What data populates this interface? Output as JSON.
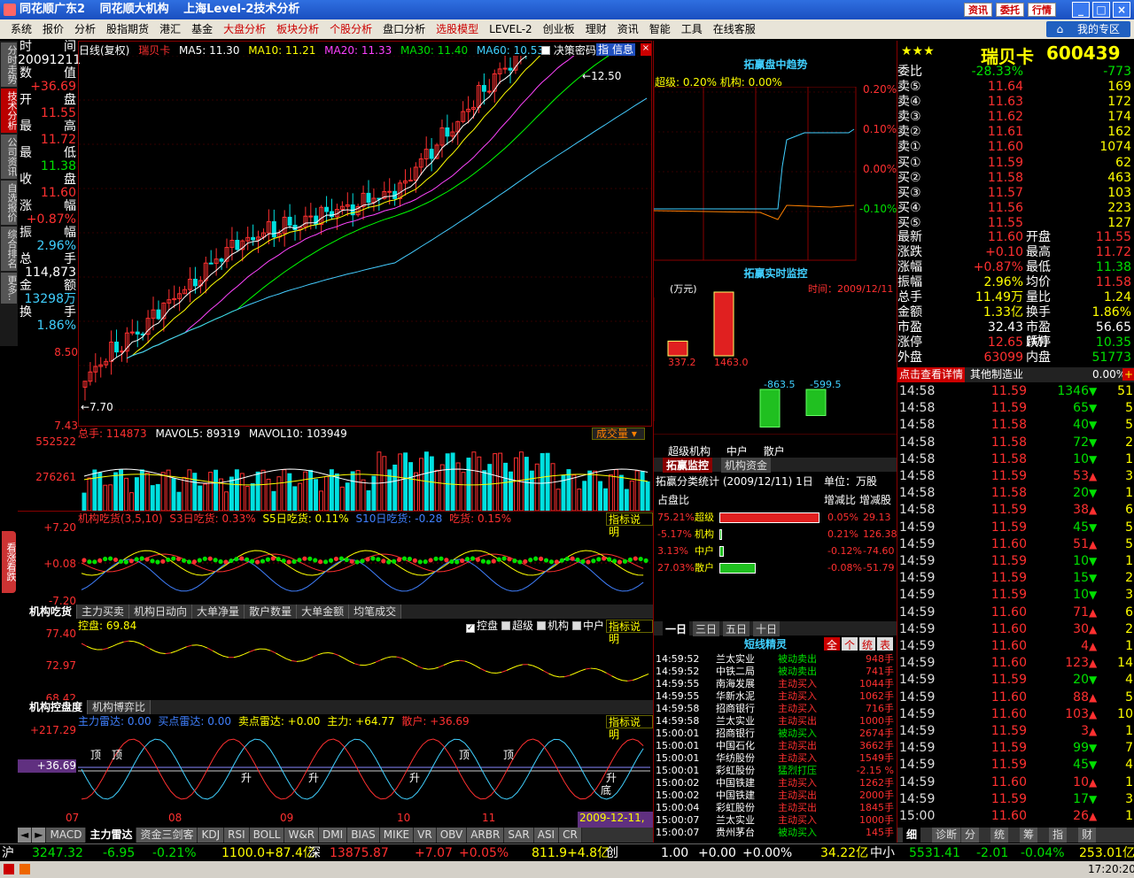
{
  "titlebar": {
    "app": "同花顺广东2",
    "mode": "同花顺大机构",
    "page": "上海Level-2技术分析",
    "btn1": "资讯",
    "btn2": "委托",
    "btn3": "行情"
  },
  "menu": {
    "items": [
      "系统",
      "报价",
      "分析",
      "股指期货",
      "港汇",
      "基金",
      "大盘分析",
      "板块分析",
      "个股分析",
      "盘口分析",
      "选股模型",
      "LEVEL-2",
      "创业板",
      "理财",
      "资讯",
      "智能",
      "工具",
      "在线客服"
    ],
    "red_items": [
      "大盘分析",
      "板块分析",
      "个股分析",
      "选股模型"
    ],
    "myzone": "我的专区"
  },
  "left_tabs": [
    "分时走势",
    "技术分析",
    "公司资讯",
    "自选报价",
    "综合排名",
    "更多.."
  ],
  "info": {
    "rows": [
      {
        "l": "时",
        "r": "间"
      },
      {
        "val": "20091211",
        "color": "white"
      },
      {
        "l": "数",
        "r": "值"
      },
      {
        "val": "+36.69",
        "color": "red"
      },
      {
        "l": "开",
        "r": "盘"
      },
      {
        "val": "11.55",
        "color": "red"
      },
      {
        "l": "最",
        "r": "高"
      },
      {
        "val": "11.72",
        "color": "red"
      },
      {
        "l": "最",
        "r": "低"
      },
      {
        "val": "11.38",
        "color": "green"
      },
      {
        "l": "收",
        "r": "盘"
      },
      {
        "val": "11.60",
        "color": "red"
      },
      {
        "l": "涨",
        "r": "幅"
      },
      {
        "val": "+0.87%",
        "color": "red"
      },
      {
        "l": "振",
        "r": "幅"
      },
      {
        "val": "2.96%",
        "color": "cyan"
      },
      {
        "l": "总",
        "r": "手"
      },
      {
        "val": "114,873",
        "color": "white"
      },
      {
        "l": "金",
        "r": "额"
      },
      {
        "val": "13298万",
        "color": "cyan"
      },
      {
        "l": "换",
        "r": "手"
      },
      {
        "val": "1.86%",
        "color": "cyan"
      }
    ],
    "price_axis": [
      "8.50",
      "7.43"
    ]
  },
  "main_chart": {
    "header": {
      "label": "日线(复权)",
      "name": "瑞贝卡",
      "ma5": "MA5: 11.30",
      "ma10": "MA10: 11.21",
      "ma20": "MA20: 11.33",
      "ma30": "MA30: 11.40",
      "ma60": "MA60: 10.53"
    },
    "decision": "决策密码",
    "icons": [
      "指",
      "信息"
    ],
    "high_label": "12.50",
    "low_label": "7.70"
  },
  "vol_panel": {
    "header": "总手: 114873",
    "mavol5": "MAVOL5: 89319",
    "mavol10": "MAVOL10: 103949",
    "select": "成交量",
    "axis": [
      "552522",
      "276261"
    ]
  },
  "inst_panel": {
    "header": "机构吃货(3,5,10)",
    "s3": "S3日吃货: 0.33%",
    "s5": "S5日吃货: 0.11%",
    "s10": "S10日吃货: -0.28",
    "eat": "吃货: 0.15%",
    "explain": "指标说明",
    "axis": [
      "+7.20",
      "+0.08",
      "-7.20"
    ],
    "side_tab": "看涨看跌"
  },
  "tabs1": [
    "机构吃货",
    "主力买卖",
    "机构日动向",
    "大单净量",
    "散户数量",
    "大单金额",
    "均笔成交"
  ],
  "ctrl_panel": {
    "header": "控盘: 69.84",
    "checks": [
      "控盘",
      "超级",
      "机构",
      "中户"
    ],
    "explain": "指标说明",
    "axis": [
      "77.40",
      "72.97",
      "68.42"
    ]
  },
  "tabs2": [
    "机构控盘度",
    "机构博弈比"
  ],
  "radar_panel": {
    "header": "主力雷达: 0.00",
    "buy": "买点雷达: 0.00",
    "sell": "卖点雷达: +0.00",
    "main": "主力: +64.77",
    "retail": "散户: +36.69",
    "explain": "指标说明",
    "axis": [
      "+217.29",
      "+36.69"
    ],
    "markers": [
      "顶",
      "顶",
      "顶",
      "顶",
      "升",
      "升",
      "升",
      "升",
      "底"
    ]
  },
  "date_axis": [
    "07",
    "08",
    "09",
    "10",
    "11",
    "2009-12-11,五"
  ],
  "bottom_tabs": [
    "MACD",
    "主力雷达",
    "资金三剑客",
    "KDJ",
    "RSI",
    "BOLL",
    "W&R",
    "DMI",
    "BIAS",
    "MIKE",
    "VR",
    "OBV",
    "ARBR",
    "SAR",
    "ASI",
    "CR"
  ],
  "mid": {
    "trend_title": "拓赢盘中趋势",
    "trend_hdr": "超级: 0.20%  机构: 0.00%",
    "trend_axis": [
      "0.20%",
      "0.10%",
      "0.00%",
      "-0.10%"
    ],
    "monitor_title": "拓赢实时监控",
    "monitor_unit": "(万元)",
    "monitor_time": "时间：2009/12/11",
    "bars": [
      {
        "v": "337.2",
        "val": 337.2
      },
      {
        "v": "1463.0",
        "val": 1463.0
      },
      {
        "v": "-863.5",
        "val": -863.5
      },
      {
        "v": "-599.5",
        "val": -599.5
      }
    ],
    "bar_labels": [
      "超级机构",
      "机构",
      "中户",
      "散户"
    ],
    "tabs": [
      "拓赢监控",
      "机构资金"
    ],
    "stat_title": "拓赢分类统计 (2009/12/11) 1日",
    "stat_unit": "单位：万股",
    "stat_hdr": [
      "占盘比",
      "增减比",
      "增减股"
    ],
    "stats": [
      {
        "pct": "75.21%",
        "name": "超级",
        "chg": "0.05%",
        "vol": "29.13",
        "w": 0.75
      },
      {
        "pct": "-5.17%",
        "name": "机构",
        "chg": "0.21%",
        "vol": "126.38",
        "w": 0.0
      },
      {
        "pct": "3.13%",
        "name": "中户",
        "chg": "-0.12%",
        "vol": "-74.60",
        "w": 0.03
      },
      {
        "pct": "27.03%",
        "name": "散户",
        "chg": "-0.08%",
        "vol": "-51.79",
        "w": 0.27
      }
    ],
    "period_tabs": [
      "一日",
      "三日",
      "五日",
      "十日"
    ],
    "sprite_title": "短线精灵",
    "sprite_btns": [
      "全",
      "个",
      "统",
      "表"
    ],
    "sprites": [
      {
        "t": "14:59:52",
        "s": "兰太实业",
        "a": "被动卖出",
        "v": "948手"
      },
      {
        "t": "14:59:52",
        "s": "中铁二局",
        "a": "被动卖出",
        "v": "741手"
      },
      {
        "t": "14:59:55",
        "s": "南海发展",
        "a": "主动买入",
        "v": "1044手"
      },
      {
        "t": "14:59:55",
        "s": "华新水泥",
        "a": "主动买入",
        "v": "1062手"
      },
      {
        "t": "14:59:58",
        "s": "招商银行",
        "a": "主动买入",
        "v": "716手"
      },
      {
        "t": "14:59:58",
        "s": "兰太实业",
        "a": "主动买出",
        "v": "1000手"
      },
      {
        "t": "15:00:01",
        "s": "招商银行",
        "a": "被动买入",
        "v": "2674手"
      },
      {
        "t": "15:00:01",
        "s": "中国石化",
        "a": "主动买出",
        "v": "3662手"
      },
      {
        "t": "15:00:01",
        "s": "华纺股份",
        "a": "主动买入",
        "v": "1549手"
      },
      {
        "t": "15:00:01",
        "s": "彩虹股份",
        "a": "猛烈打压",
        "v": "-2.15 %"
      },
      {
        "t": "15:00:02",
        "s": "中国铁建",
        "a": "主动买入",
        "v": "1262手"
      },
      {
        "t": "15:00:02",
        "s": "中国铁建",
        "a": "主动买出",
        "v": "2000手"
      },
      {
        "t": "15:00:04",
        "s": "彩虹股份",
        "a": "主动买出",
        "v": "1845手"
      },
      {
        "t": "15:00:07",
        "s": "兰太实业",
        "a": "主动买入",
        "v": "1000手"
      },
      {
        "t": "15:00:07",
        "s": "贵州茅台",
        "a": "被动买入",
        "v": "145手"
      }
    ]
  },
  "right": {
    "stars": "★★★",
    "name": "瑞贝卡",
    "code": "600439",
    "weibi": {
      "l": "委比",
      "v": "-28.33%",
      "n": "-773"
    },
    "asks": [
      {
        "l": "卖⑤",
        "p": "11.64",
        "n": "169"
      },
      {
        "l": "卖④",
        "p": "11.63",
        "n": "172"
      },
      {
        "l": "卖③",
        "p": "11.62",
        "n": "174"
      },
      {
        "l": "卖②",
        "p": "11.61",
        "n": "162"
      },
      {
        "l": "卖①",
        "p": "11.60",
        "n": "1074"
      }
    ],
    "bids": [
      {
        "l": "买①",
        "p": "11.59",
        "n": "62"
      },
      {
        "l": "买②",
        "p": "11.58",
        "n": "463"
      },
      {
        "l": "买③",
        "p": "11.57",
        "n": "103"
      },
      {
        "l": "买④",
        "p": "11.56",
        "n": "223"
      },
      {
        "l": "买⑤",
        "p": "11.55",
        "n": "127"
      }
    ],
    "stats": [
      {
        "l1": "最新",
        "v1": "11.60",
        "c1": "red",
        "l2": "开盘",
        "v2": "11.55",
        "c2": "red"
      },
      {
        "l1": "涨跌",
        "v1": "+0.10",
        "c1": "red",
        "l2": "最高",
        "v2": "11.72",
        "c2": "red"
      },
      {
        "l1": "涨幅",
        "v1": "+0.87%",
        "c1": "red",
        "l2": "最低",
        "v2": "11.38",
        "c2": "green"
      },
      {
        "l1": "振幅",
        "v1": "2.96%",
        "c1": "yellow",
        "l2": "均价",
        "v2": "11.58",
        "c2": "red"
      },
      {
        "l1": "总手",
        "v1": "11.49万",
        "c1": "yellow",
        "l2": "量比",
        "v2": "1.24",
        "c2": "yellow"
      },
      {
        "l1": "金额",
        "v1": "1.33亿",
        "c1": "yellow",
        "l2": "换手",
        "v2": "1.86%",
        "c2": "yellow"
      },
      {
        "l1": "市盈",
        "v1": "32.43",
        "c1": "white",
        "l2": "市盈(动)",
        "v2": "56.65",
        "c2": "white"
      },
      {
        "l1": "涨停",
        "v1": "12.65",
        "c1": "red",
        "l2": "跌停",
        "v2": "10.35",
        "c2": "green"
      },
      {
        "l1": "外盘",
        "v1": "63099",
        "c1": "red",
        "l2": "内盘",
        "v2": "51773",
        "c2": "green"
      }
    ],
    "detail_btn": "点击查看详情",
    "industry": "其他制造业",
    "industry_pct": "0.00%",
    "ticks": [
      {
        "t": "14:58",
        "p": "11.59",
        "v": "1346",
        "d": "down",
        "n": "51"
      },
      {
        "t": "14:58",
        "p": "11.59",
        "v": "65",
        "d": "down",
        "n": "5"
      },
      {
        "t": "14:58",
        "p": "11.58",
        "v": "40",
        "d": "down",
        "n": "5"
      },
      {
        "t": "14:58",
        "p": "11.58",
        "v": "72",
        "d": "down",
        "n": "2"
      },
      {
        "t": "14:58",
        "p": "11.58",
        "v": "10",
        "d": "down",
        "n": "1"
      },
      {
        "t": "14:58",
        "p": "11.59",
        "v": "53",
        "d": "up",
        "n": "3"
      },
      {
        "t": "14:58",
        "p": "11.58",
        "v": "20",
        "d": "down",
        "n": "1"
      },
      {
        "t": "14:58",
        "p": "11.59",
        "v": "38",
        "d": "up",
        "n": "6"
      },
      {
        "t": "14:59",
        "p": "11.59",
        "v": "45",
        "d": "down",
        "n": "5"
      },
      {
        "t": "14:59",
        "p": "11.60",
        "v": "51",
        "d": "up",
        "n": "5"
      },
      {
        "t": "14:59",
        "p": "11.59",
        "v": "10",
        "d": "down",
        "n": "1"
      },
      {
        "t": "14:59",
        "p": "11.59",
        "v": "15",
        "d": "down",
        "n": "2"
      },
      {
        "t": "14:59",
        "p": "11.59",
        "v": "10",
        "d": "down",
        "n": "3"
      },
      {
        "t": "14:59",
        "p": "11.60",
        "v": "71",
        "d": "up",
        "n": "6"
      },
      {
        "t": "14:59",
        "p": "11.60",
        "v": "30",
        "d": "up",
        "n": "2"
      },
      {
        "t": "14:59",
        "p": "11.60",
        "v": "4",
        "d": "up",
        "n": "1"
      },
      {
        "t": "14:59",
        "p": "11.60",
        "v": "123",
        "d": "up",
        "n": "14"
      },
      {
        "t": "14:59",
        "p": "11.59",
        "v": "20",
        "d": "down",
        "n": "4"
      },
      {
        "t": "14:59",
        "p": "11.60",
        "v": "88",
        "d": "up",
        "n": "5"
      },
      {
        "t": "14:59",
        "p": "11.60",
        "v": "103",
        "d": "up",
        "n": "10"
      },
      {
        "t": "14:59",
        "p": "11.59",
        "v": "3",
        "d": "up",
        "n": "1"
      },
      {
        "t": "14:59",
        "p": "11.59",
        "v": "99",
        "d": "down",
        "n": "7"
      },
      {
        "t": "14:59",
        "p": "11.59",
        "v": "45",
        "d": "down",
        "n": "4"
      },
      {
        "t": "14:59",
        "p": "11.60",
        "v": "10",
        "d": "up",
        "n": "1"
      },
      {
        "t": "14:59",
        "p": "11.59",
        "v": "17",
        "d": "down",
        "n": "3"
      },
      {
        "t": "15:00",
        "p": "11.60",
        "v": "26",
        "d": "up",
        "n": "1"
      }
    ],
    "bottom_tabs": [
      "细",
      "诊断",
      "分",
      "统",
      "筹",
      "指",
      "财"
    ]
  },
  "status": {
    "sh_lbl": "沪",
    "sh": "3247.32",
    "sh_chg": "-6.95",
    "sh_pct": "-0.21%",
    "sh_amt": "1100.0+87.4亿",
    "sz_lbl": "深",
    "sz": "13875.87",
    "sz_chg": "+7.07",
    "sz_pct": "+0.05%",
    "sz_amt": "811.9+4.8亿",
    "cy_lbl": "创",
    "cy": "1.00",
    "cy_chg": "+0.00",
    "cy_pct": "+0.00%",
    "cy_amt": "34.22亿",
    "zx_lbl": "中小",
    "zx": "5531.41",
    "zx_chg": "-2.01",
    "zx_pct": "-0.04%",
    "zx_amt": "253.01亿"
  },
  "clock": "17:20:20"
}
